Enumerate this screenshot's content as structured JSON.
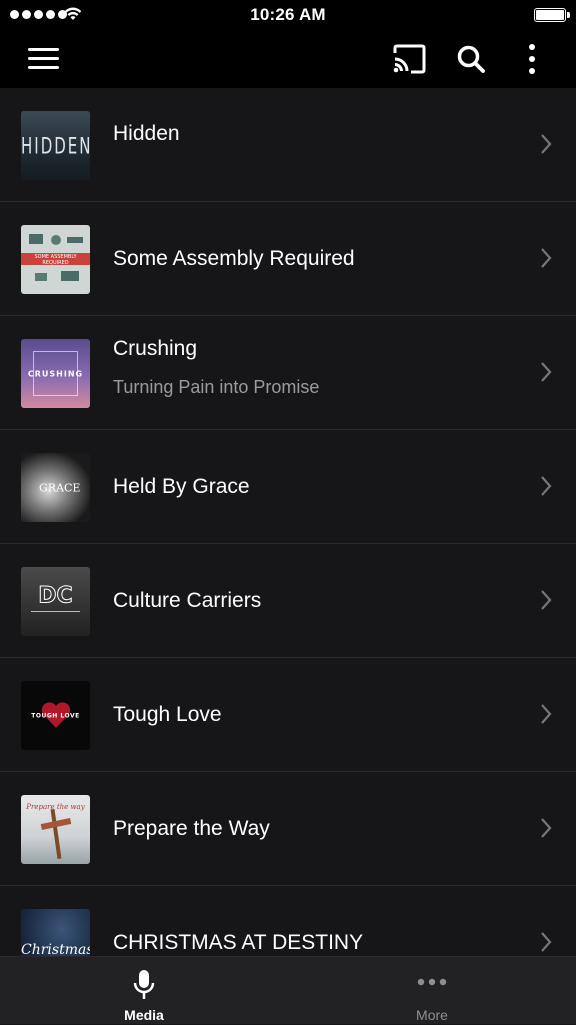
{
  "status_bar": {
    "time": "10:26 AM"
  },
  "colors": {
    "background": "#161618",
    "bar": "#000000",
    "tabbar": "#222224",
    "subtitle": "#9a9aa0",
    "divider": "#2c2c2e",
    "tab_active": "#ffffff",
    "tab_inactive": "#8e8e93"
  },
  "header": {
    "icons": [
      "menu-icon",
      "cast-icon",
      "search-icon",
      "more-vertical-icon"
    ]
  },
  "series": [
    {
      "title": "Hidden",
      "subtitle": "",
      "art_text": "HIDDEN"
    },
    {
      "title": "Some Assembly Required",
      "subtitle": "",
      "art_text": "SOME ASSEMBLY REQUIRED"
    },
    {
      "title": "Crushing",
      "subtitle": "Turning Pain into Promise",
      "art_text": "CRUSHING"
    },
    {
      "title": "Held By Grace",
      "subtitle": "",
      "art_text": "GRACE"
    },
    {
      "title": "Culture Carriers",
      "subtitle": "",
      "art_text": "DC"
    },
    {
      "title": "Tough Love",
      "subtitle": "",
      "art_text": "TOUGH LOVE"
    },
    {
      "title": "Prepare the Way",
      "subtitle": "",
      "art_text": "Prepare the way"
    },
    {
      "title": "CHRISTMAS AT DESTINY",
      "subtitle": "",
      "art_text": "Christmas"
    }
  ],
  "tabbar": {
    "tabs": [
      {
        "label": "Media",
        "icon": "microphone-icon",
        "active": true
      },
      {
        "label": "More",
        "icon": "more-horizontal-icon",
        "active": false
      }
    ]
  }
}
